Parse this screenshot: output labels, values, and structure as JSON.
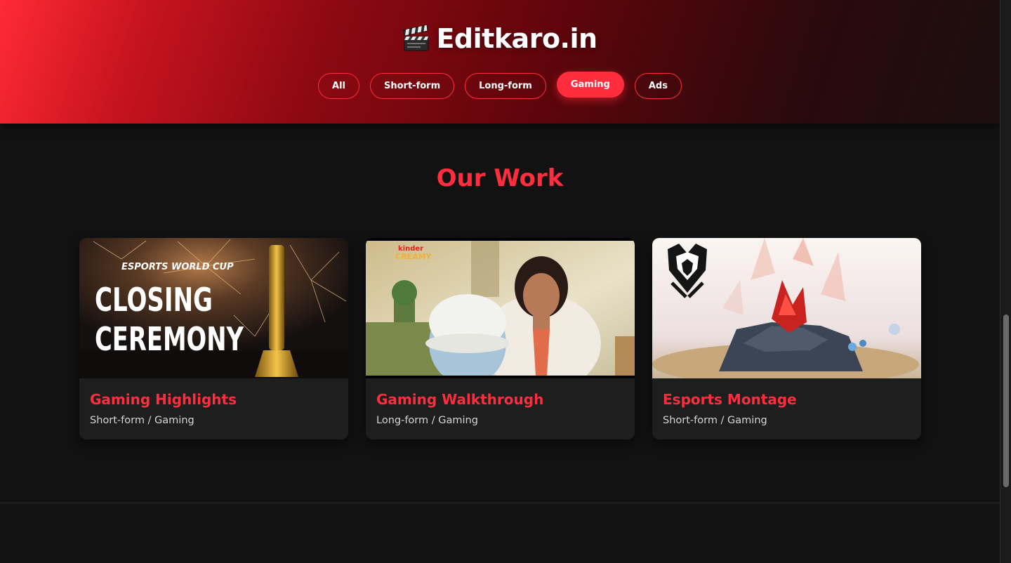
{
  "brand": {
    "icon": "clapperboard-icon",
    "name": "Editkaro.in"
  },
  "filters": [
    {
      "label": "All",
      "active": false
    },
    {
      "label": "Short-form",
      "active": false
    },
    {
      "label": "Long-form",
      "active": false
    },
    {
      "label": "Gaming",
      "active": true
    },
    {
      "label": "Ads",
      "active": false
    }
  ],
  "section": {
    "title": "Our Work"
  },
  "cards": [
    {
      "title": "Gaming Highlights",
      "meta": "Short-form / Gaming",
      "thumb": {
        "logo": "ESPORTS WORLD CUP",
        "line1": "CLOSING",
        "line2": "CEREMONY"
      }
    },
    {
      "title": "Gaming Walkthrough",
      "meta": "Long-form / Gaming",
      "thumb": {
        "logo_top": "kinder",
        "logo_bottom": "CREAMY"
      }
    },
    {
      "title": "Esports Montage",
      "meta": "Short-form / Gaming",
      "thumb": {
        "icon": "worlds-emblem-icon"
      }
    }
  ],
  "colors": {
    "accent": "#ff2d3d",
    "background": "#121212",
    "card": "#1e1e1e"
  }
}
